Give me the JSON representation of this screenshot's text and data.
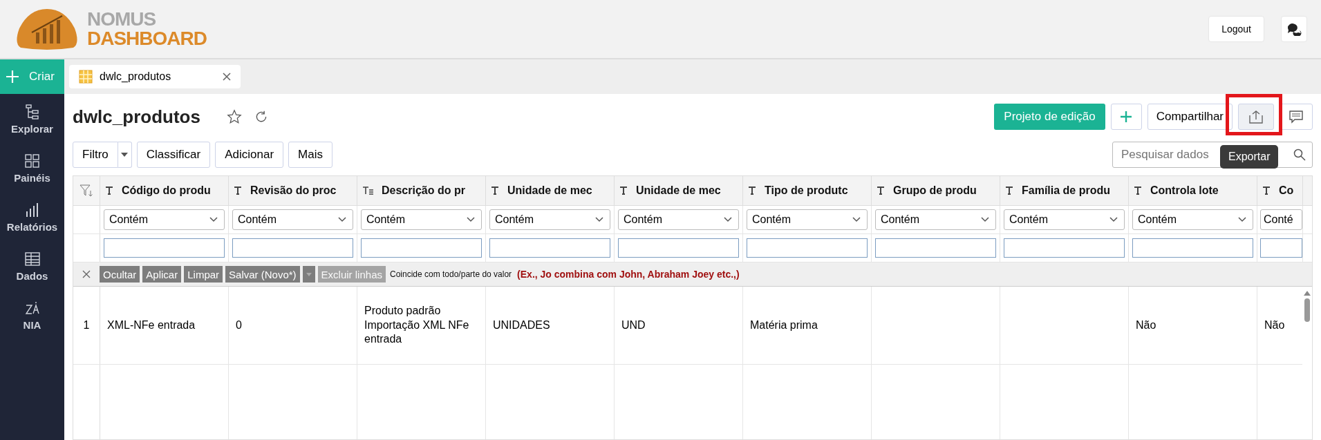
{
  "header": {
    "logo_line1": "NOMUS",
    "logo_line2": "DASHBOARD",
    "logout": "Logout"
  },
  "sidebar": {
    "create": "Criar",
    "items": [
      {
        "label": "Explorar",
        "kind": "tree",
        "selected": false
      },
      {
        "label": "Painéis",
        "kind": "panels",
        "selected": false
      },
      {
        "label": "Relatórios",
        "kind": "bars",
        "selected": false
      },
      {
        "label": "Dados",
        "kind": "grid",
        "selected": false
      },
      {
        "label": "NIA",
        "kind": "nia",
        "selected": false
      }
    ]
  },
  "tabs": [
    {
      "label": "dwlc_produtos",
      "selected": true
    }
  ],
  "view": {
    "title": "dwlc_produtos",
    "favorite": false,
    "actions": {
      "edit_project": "Projeto de edição",
      "share": "Compartilhar",
      "export_tooltip": "Exportar",
      "export_highlighted": true
    },
    "toolbar": [
      "Filtro",
      "Classificar",
      "Adicionar",
      "Mais"
    ],
    "search": {
      "placeholder": "Pesquisar dados"
    }
  },
  "table": {
    "columns": [
      {
        "label": "Código do produ",
        "kind": "text",
        "operator": "Contém"
      },
      {
        "label": "Revisão do proc",
        "kind": "text",
        "operator": "Contém"
      },
      {
        "label": "Descrição do pr",
        "kind": "multiline",
        "operator": "Contém"
      },
      {
        "label": "Unidade de mec",
        "kind": "text",
        "operator": "Contém"
      },
      {
        "label": "Unidade de mec",
        "kind": "text",
        "operator": "Contém"
      },
      {
        "label": "Tipo de produtc",
        "kind": "text",
        "operator": "Contém"
      },
      {
        "label": "Grupo de produ",
        "kind": "text",
        "operator": "Contém"
      },
      {
        "label": "Família de produ",
        "kind": "text",
        "operator": "Contém"
      },
      {
        "label": "Controla lote",
        "kind": "text",
        "operator": "Contém"
      },
      {
        "label": "Co",
        "kind": "text",
        "operator": "Conté"
      }
    ],
    "filter_bar": {
      "buttons": [
        {
          "label": "Ocultar",
          "disabled": false
        },
        {
          "label": "Aplicar",
          "disabled": false
        },
        {
          "label": "Limpar",
          "disabled": false
        },
        {
          "label": "Salvar (Novo*)",
          "disabled": false
        },
        {
          "label": "Excluir linhas",
          "disabled": true
        }
      ],
      "hint": "Coincide com todo/parte do valor",
      "example": "(Ex., Jo combina com John, Abraham Joey etc.,)"
    },
    "rows": [
      {
        "number": "1",
        "cells": [
          "XML-NFe entrada",
          "0",
          "Produto padrão Importação XML NFe entrada",
          "UNIDADES",
          "UND",
          "Matéria prima",
          "",
          "",
          "Não",
          "Não"
        ]
      }
    ]
  }
}
